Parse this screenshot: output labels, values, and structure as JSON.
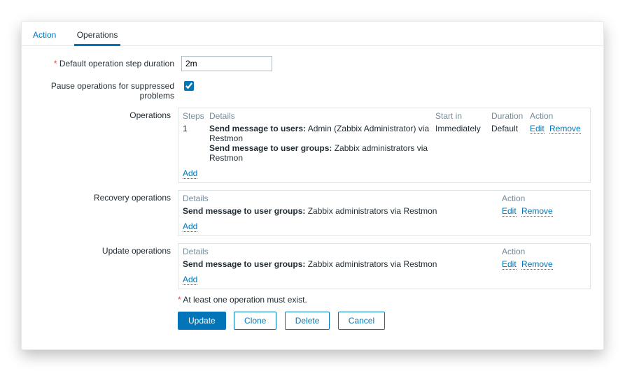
{
  "tabs": {
    "action": "Action",
    "operations": "Operations"
  },
  "form": {
    "default_step_label": "Default operation step duration",
    "default_step_value": "2m",
    "pause_label": "Pause operations for suppressed problems",
    "pause_checked": true
  },
  "operations": {
    "label": "Operations",
    "headers": {
      "steps": "Steps",
      "details": "Details",
      "start": "Start in",
      "duration": "Duration",
      "action": "Action"
    },
    "row": {
      "step": "1",
      "line1_bold": "Send message to users:",
      "line1_rest": " Admin (Zabbix Administrator) via Restmon",
      "line2_bold": "Send message to user groups:",
      "line2_rest": " Zabbix administrators via Restmon",
      "start": "Immediately",
      "duration": "Default"
    },
    "edit": "Edit",
    "remove": "Remove",
    "add": "Add"
  },
  "recovery": {
    "label": "Recovery operations",
    "headers": {
      "details": "Details",
      "action": "Action"
    },
    "row": {
      "bold": "Send message to user groups:",
      "rest": " Zabbix administrators via Restmon"
    },
    "edit": "Edit",
    "remove": "Remove",
    "add": "Add"
  },
  "update": {
    "label": "Update operations",
    "headers": {
      "details": "Details",
      "action": "Action"
    },
    "row": {
      "bold": "Send message to user groups:",
      "rest": " Zabbix administrators via Restmon"
    },
    "edit": "Edit",
    "remove": "Remove",
    "add": "Add"
  },
  "footer": {
    "note": "At least one operation must exist.",
    "update": "Update",
    "clone": "Clone",
    "delete": "Delete",
    "cancel": "Cancel"
  }
}
